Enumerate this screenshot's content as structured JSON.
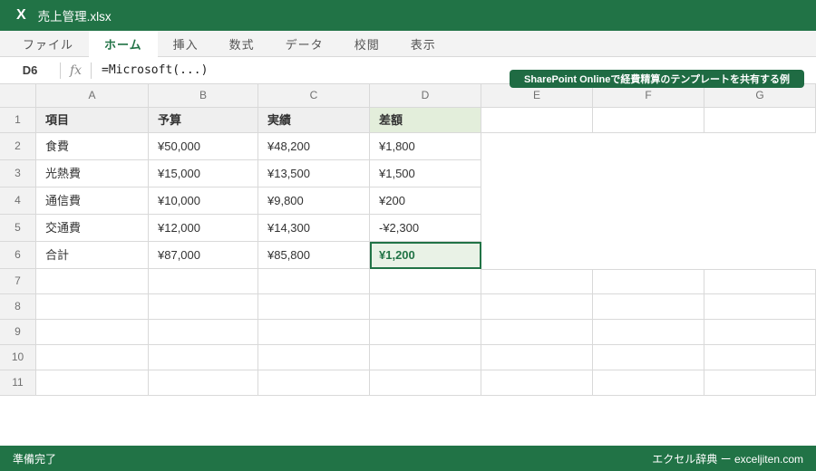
{
  "window": {
    "logo": "X",
    "title": "売上管理.xlsx"
  },
  "ribbon": {
    "tabs": [
      {
        "name": "file",
        "label": "ファイル",
        "active": false
      },
      {
        "name": "home",
        "label": "ホーム",
        "active": true
      },
      {
        "name": "insert",
        "label": "挿入",
        "active": false
      },
      {
        "name": "formulas",
        "label": "数式",
        "active": false
      },
      {
        "name": "data",
        "label": "データ",
        "active": false
      },
      {
        "name": "review",
        "label": "校閲",
        "active": false
      },
      {
        "name": "view",
        "label": "表示",
        "active": false
      }
    ]
  },
  "formula_bar": {
    "cell_ref": "D6",
    "fx_label": "fx",
    "formula": "=Microsoft(...)"
  },
  "tooltip": {
    "text": "SharePoint Onlineで経費精算のテンプレートを共有する例"
  },
  "sheet": {
    "column_headers": [
      "A",
      "B",
      "C",
      "D",
      "E",
      "F",
      "G"
    ],
    "selected_cell": "D6",
    "rows": [
      {
        "num": "1",
        "cells": [
          "項目",
          "予算",
          "実績",
          "差額",
          "",
          "",
          ""
        ]
      },
      {
        "num": "2",
        "cells": [
          "食費",
          "¥50,000",
          "¥48,200",
          "¥1,800",
          "",
          "",
          ""
        ]
      },
      {
        "num": "3",
        "cells": [
          "光熱費",
          "¥15,000",
          "¥13,500",
          "¥1,500",
          "",
          "",
          ""
        ]
      },
      {
        "num": "4",
        "cells": [
          "通信費",
          "¥10,000",
          "¥9,800",
          "¥200",
          "",
          "",
          ""
        ]
      },
      {
        "num": "5",
        "cells": [
          "交通費",
          "¥12,000",
          "¥14,300",
          "-¥2,300",
          "",
          "",
          ""
        ]
      },
      {
        "num": "6",
        "cells": [
          "合計",
          "¥87,000",
          "¥85,800",
          "¥1,200",
          "",
          "",
          ""
        ]
      },
      {
        "num": "7",
        "cells": [
          "",
          "",
          "",
          "",
          "",
          "",
          ""
        ]
      },
      {
        "num": "8",
        "cells": [
          "",
          "",
          "",
          "",
          "",
          "",
          ""
        ]
      },
      {
        "num": "9",
        "cells": [
          "",
          "",
          "",
          "",
          "",
          "",
          ""
        ]
      },
      {
        "num": "10",
        "cells": [
          "",
          "",
          "",
          "",
          "",
          "",
          ""
        ]
      },
      {
        "num": "11",
        "cells": [
          "",
          "",
          "",
          "",
          "",
          "",
          ""
        ]
      }
    ]
  },
  "status_bar": {
    "left": "準備完了",
    "right": "エクセル辞典 ー exceljiten.com"
  },
  "colors": {
    "brand_green": "#217346",
    "tooltip_green": "#1f6b43",
    "selected_fill": "#e9f2e6",
    "header_green_fill": "#e3eedb",
    "header_gray_fill": "#efefef",
    "gridline": "#d9d9d9"
  }
}
